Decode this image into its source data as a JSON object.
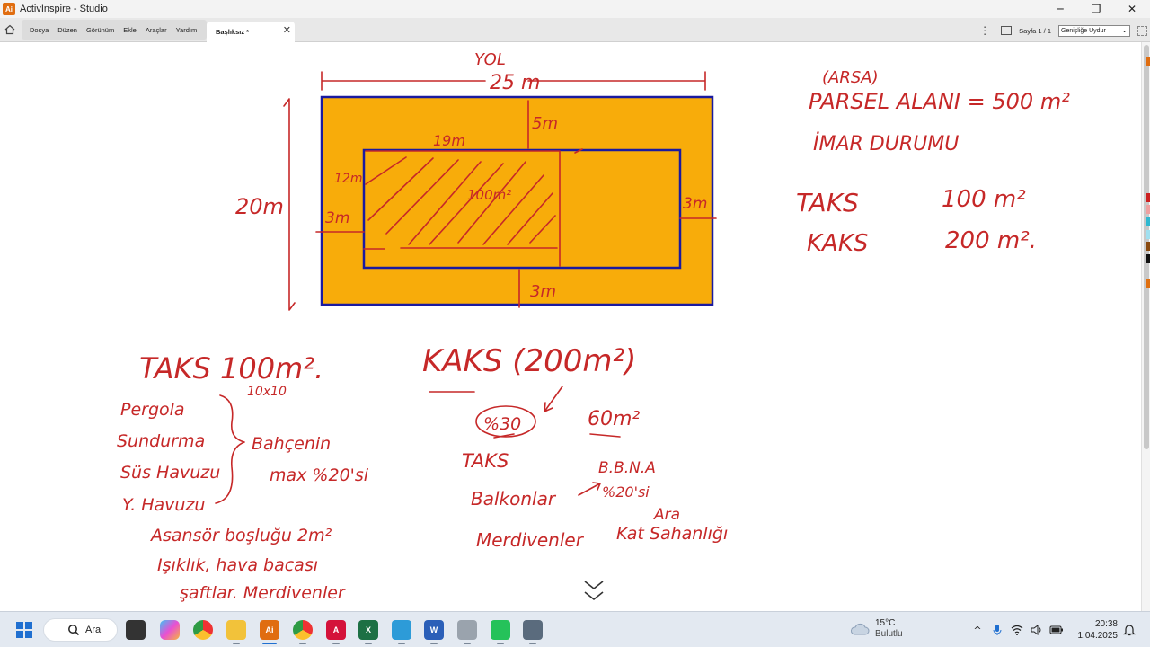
{
  "window": {
    "title": "ActivInspire - Studio",
    "logo_text": "Ai",
    "controls": {
      "minimize": "─",
      "restore": "❐",
      "close": "✕"
    }
  },
  "menu": {
    "items": [
      "Dosya",
      "Düzen",
      "Görünüm",
      "Ekle",
      "Araçlar",
      "Yardım"
    ]
  },
  "tab": {
    "label": "Başlıksız *",
    "close": "✕"
  },
  "toolbar": {
    "page_indicator": "Sayfa 1 / 1",
    "zoom_value": "Genişliğe Uydur",
    "kebab": "⋮"
  },
  "drawing": {
    "road_label": "YOL",
    "width_label": "25 m",
    "depth_label": "20m",
    "front_setback": "5m",
    "side_setback_left": "3m",
    "side_setback_right": "3m",
    "rear_setback": "3m",
    "building_width": "19m",
    "building_depth": "12m",
    "building_area": "100m²",
    "colors": {
      "parcel_fill": "#f8ac0a",
      "outline": "#1a1aa0",
      "ink": "#c62828"
    }
  },
  "notes_right": {
    "arsa": "(ARSA)",
    "parsel_alani": "PARSEL ALANI = 500 m²",
    "imar_durumu": "İMAR DURUMU",
    "taks_label": "TAKS",
    "taks_value": "100 m²",
    "kaks_label": "KAKS",
    "kaks_value": "200 m².",
    "vertical_colors": [
      "#cc2020",
      "#f0a0a0",
      "#30b8d0",
      "#a0e0f0",
      "#8a4a10",
      "#111111",
      "#e07010"
    ]
  },
  "notes_left": {
    "taks_heading": "TAKS 100m².",
    "taks_dims": "10x10",
    "list": [
      "Pergola",
      "Sundurma",
      "Süs Havuzu",
      "Y. Havuzu"
    ],
    "brace_note_1": "Bahçenin",
    "brace_note_2": "max %20'si",
    "line_1": "Asansör boşluğu 2m²",
    "line_2": "Işıklık, hava bacası",
    "line_3": "şaftlar. Merdivenler"
  },
  "notes_center": {
    "kaks_heading": "KAKS (200m²)",
    "percent": "%30",
    "sixty": "60m²",
    "taks": "TAKS",
    "bbna": "B.B.N.A",
    "balkonlar": "Balkonlar",
    "percent20": "%20'si",
    "ara": "Ara",
    "merdivenler": "Merdivenler",
    "kat_sahanligi": "Kat Sahanlığı",
    "scroll_hint": "⌄⌄"
  },
  "taskbar": {
    "search_label": "Ara",
    "apps": [
      "Windows",
      "Görev Görünümü",
      "Copilot",
      "Chrome",
      "Dosya Gezgini",
      "ActivInspire",
      "Chrome Profili",
      "Acrobat",
      "Excel",
      "Outlook",
      "Word",
      "Uygulama",
      "Kamera",
      "Hesap Makinesi"
    ],
    "weather_temp": "15°C",
    "weather_cond": "Bulutlu",
    "time": "20:38",
    "date": "1.04.2025"
  }
}
